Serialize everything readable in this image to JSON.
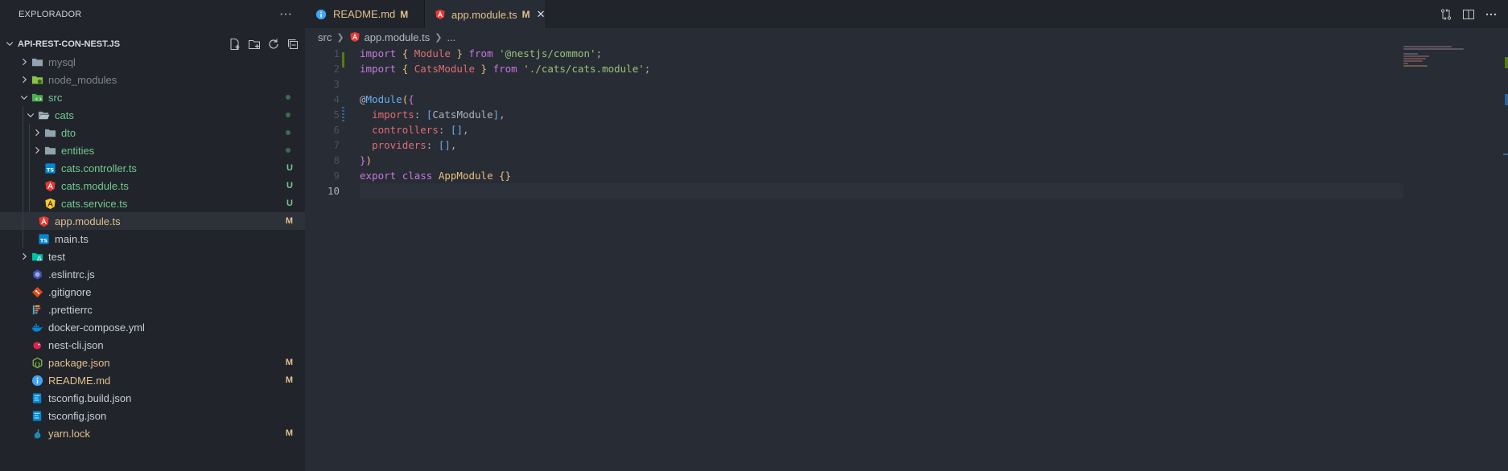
{
  "sidebar": {
    "title": "EXPLORADOR",
    "more": "···",
    "project": "API-REST-CON-NEST.JS",
    "actions": [
      "new-file",
      "new-folder",
      "refresh",
      "collapse-all"
    ],
    "items": [
      {
        "label": "mysql",
        "kind": "folder",
        "expanded": false,
        "depth": 0,
        "color": "dim"
      },
      {
        "label": "node_modules",
        "kind": "folder-node",
        "expanded": false,
        "depth": 0,
        "color": "dim"
      },
      {
        "label": "src",
        "kind": "folder-src",
        "expanded": true,
        "depth": 0,
        "color": "u",
        "status": "dot"
      },
      {
        "label": "cats",
        "kind": "folder-open",
        "expanded": true,
        "depth": 1,
        "color": "u",
        "status": "dot"
      },
      {
        "label": "dto",
        "kind": "folder",
        "expanded": false,
        "depth": 2,
        "color": "u",
        "status": "dot"
      },
      {
        "label": "entities",
        "kind": "folder",
        "expanded": false,
        "depth": 2,
        "color": "u",
        "status": "dot"
      },
      {
        "label": "cats.controller.ts",
        "kind": "file-ts-blue",
        "depth": 2,
        "color": "u",
        "status": "U"
      },
      {
        "label": "cats.module.ts",
        "kind": "file-angular",
        "depth": 2,
        "color": "u",
        "status": "U"
      },
      {
        "label": "cats.service.ts",
        "kind": "file-angular-yellow",
        "depth": 2,
        "color": "u",
        "status": "U"
      },
      {
        "label": "app.module.ts",
        "kind": "file-angular",
        "depth": 1,
        "color": "m",
        "status": "M",
        "selected": true
      },
      {
        "label": "main.ts",
        "kind": "file-ts-blue",
        "depth": 1,
        "color": "normal"
      },
      {
        "label": "test",
        "kind": "folder-test",
        "expanded": false,
        "depth": 0,
        "color": "normal"
      },
      {
        "label": ".eslintrc.js",
        "kind": "file-eslint",
        "depth": 0,
        "color": "normal"
      },
      {
        "label": ".gitignore",
        "kind": "file-git",
        "depth": 0,
        "color": "normal"
      },
      {
        "label": ".prettierrc",
        "kind": "file-prettier",
        "depth": 0,
        "color": "normal"
      },
      {
        "label": "docker-compose.yml",
        "kind": "file-docker",
        "depth": 0,
        "color": "normal"
      },
      {
        "label": "nest-cli.json",
        "kind": "file-nest",
        "depth": 0,
        "color": "normal"
      },
      {
        "label": "package.json",
        "kind": "file-node",
        "depth": 0,
        "color": "m",
        "status": "M"
      },
      {
        "label": "README.md",
        "kind": "file-info",
        "depth": 0,
        "color": "m",
        "status": "M"
      },
      {
        "label": "tsconfig.build.json",
        "kind": "file-tsconfig",
        "depth": 0,
        "color": "normal"
      },
      {
        "label": "tsconfig.json",
        "kind": "file-tsconfig",
        "depth": 0,
        "color": "normal"
      },
      {
        "label": "yarn.lock",
        "kind": "file-yarn",
        "depth": 0,
        "color": "m",
        "status": "M"
      }
    ]
  },
  "tabs": [
    {
      "label": "README.md",
      "status": "M",
      "icon": "info-icon",
      "active": false
    },
    {
      "label": "app.module.ts",
      "status": "M",
      "icon": "angular-icon",
      "active": true,
      "close": "✕"
    }
  ],
  "editor_actions": [
    "compare-changes-icon",
    "split-editor-icon",
    "more-actions-icon"
  ],
  "breadcrumb": {
    "folder": "src",
    "file": "app.module.ts",
    "ellipsis": "..."
  },
  "code": {
    "line_numbers": [
      "1",
      "2",
      "3",
      "4",
      "5",
      "6",
      "7",
      "8",
      "9",
      "10"
    ],
    "current_line": 10
  },
  "colors": {
    "git_untracked": "#73c991",
    "git_modified": "#e2c08d",
    "editor_bg": "#282c34",
    "sidebar_bg": "#21252b"
  }
}
